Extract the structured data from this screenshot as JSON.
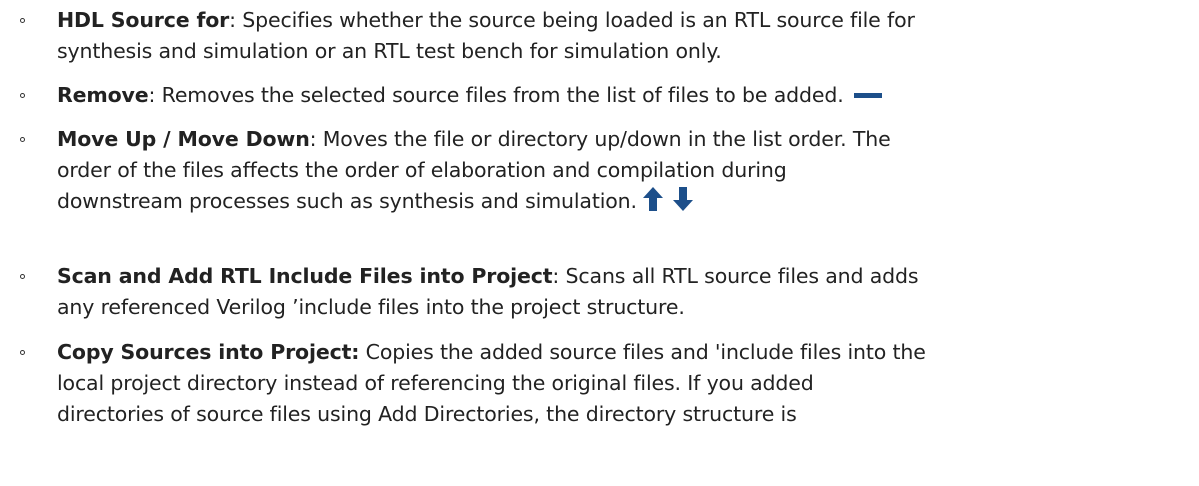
{
  "colors": {
    "icon_blue": "#1d4f8a",
    "text": "#222222"
  },
  "items": [
    {
      "term": "HDL Source for",
      "separator": ":",
      "line1": " Specifies whether the source being loaded is an RTL source file for",
      "line2": "synthesis and simulation or an RTL test bench for simulation only."
    },
    {
      "term": "Remove",
      "separator": ":",
      "line1": " Removes the selected source files from the list of files to be added.",
      "icon": "minus-icon"
    },
    {
      "term": "Move Up / Move Down",
      "separator": ":",
      "line1": " Moves the file or directory up/down in the list order. The",
      "line2": "order of the files affects the order of elaboration and compilation during",
      "line3": "downstream processes such as synthesis and simulation.",
      "icons": [
        "arrow-up-icon",
        "arrow-down-icon"
      ]
    },
    {
      "term": "Scan and Add RTL Include Files into Project",
      "separator": ":",
      "line1": " Scans all RTL source files and adds",
      "line2": "any referenced Verilog ’include files into the project structure."
    },
    {
      "term": "Copy Sources into Project:",
      "separator": "",
      "line1": " Copies the added source files and 'include files into the",
      "line2": "local project directory instead of referencing the original files. If you added",
      "line3": "directories of source files using Add Directories, the directory structure is"
    }
  ]
}
